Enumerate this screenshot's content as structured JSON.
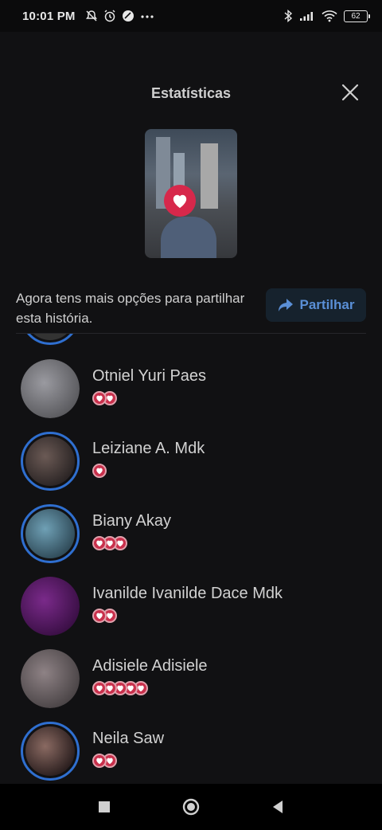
{
  "status_bar": {
    "time": "10:01 PM",
    "battery": "62",
    "icons_left": [
      "mute-icon",
      "alarm-icon",
      "app-icon",
      "more-icon"
    ],
    "icons_right": [
      "bluetooth-icon",
      "signal-icon",
      "wifi-icon",
      "battery-icon"
    ]
  },
  "header": {
    "title": "Estatísticas"
  },
  "share": {
    "text": "Agora tens mais opções para partilhar esta história.",
    "button_label": "Partilhar"
  },
  "viewers": [
    {
      "name": "Otniel Yuri Paes",
      "reactions": 2,
      "ring": false,
      "colors": [
        "#5a5a5e",
        "#9a9aa0"
      ]
    },
    {
      "name": "Leiziane A. Mdk",
      "reactions": 1,
      "ring": true,
      "colors": [
        "#2a2424",
        "#6b5a55"
      ]
    },
    {
      "name": "Biany Akay",
      "reactions": 3,
      "ring": true,
      "colors": [
        "#2f4a58",
        "#6fa0b5"
      ]
    },
    {
      "name": "Ivanilde Ivanilde Dace Mdk",
      "reactions": 2,
      "ring": false,
      "colors": [
        "#3a0f45",
        "#7a2a8a"
      ]
    },
    {
      "name": "Adisiele Adisiele",
      "reactions": 5,
      "ring": false,
      "colors": [
        "#4a4446",
        "#8e8285"
      ]
    },
    {
      "name": "Neila Saw",
      "reactions": 2,
      "ring": true,
      "colors": [
        "#2a1e1e",
        "#8a6a62"
      ]
    }
  ],
  "nav": [
    "recent-apps-button",
    "home-button",
    "back-button"
  ],
  "colors": {
    "accent": "#2f6fd0",
    "heart": "#d7284b",
    "background": "#111113"
  }
}
